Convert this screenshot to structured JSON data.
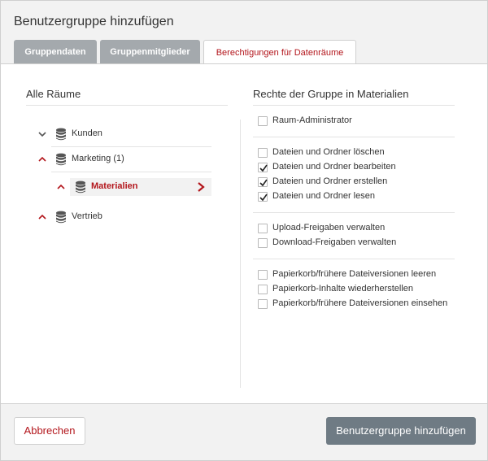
{
  "dialog": {
    "title": "Benutzergruppe hinzufügen"
  },
  "tabs": [
    {
      "label": "Gruppendaten",
      "active": false
    },
    {
      "label": "Gruppenmitglieder",
      "active": false
    },
    {
      "label": "Berechtigungen für Datenräume",
      "active": true
    }
  ],
  "rooms": {
    "title": "Alle Räume",
    "items": [
      {
        "label": "Kunden",
        "expanded": false,
        "icon": "database-icon"
      },
      {
        "label": "Marketing (1)",
        "expanded": true,
        "icon": "database-icon"
      },
      {
        "label": "Materialien",
        "expanded": true,
        "selected": true,
        "icon": "database-icon"
      },
      {
        "label": "Vertrieb",
        "expanded": true,
        "icon": "database-icon"
      }
    ]
  },
  "permissions": {
    "title": "Rechte der Gruppe in Materialien",
    "items": [
      {
        "label": "Raum-Administrator",
        "checked": false
      },
      {
        "label": "Dateien und Ordner löschen",
        "checked": false
      },
      {
        "label": "Dateien und Ordner bearbeiten",
        "checked": true
      },
      {
        "label": "Dateien und Ordner erstellen",
        "checked": true
      },
      {
        "label": "Dateien und Ordner lesen",
        "checked": true
      },
      {
        "label": "Upload-Freigaben verwalten",
        "checked": false
      },
      {
        "label": "Download-Freigaben verwalten",
        "checked": false
      },
      {
        "label": "Papierkorb/frühere Dateiversionen leeren",
        "checked": false
      },
      {
        "label": "Papierkorb-Inhalte wiederherstellen",
        "checked": false
      },
      {
        "label": "Papierkorb/frühere Dateiversionen einsehen",
        "checked": false
      }
    ]
  },
  "footer": {
    "cancel_label": "Abbrechen",
    "submit_label": "Benutzergruppe hinzufügen"
  },
  "colors": {
    "accent": "#b3161c",
    "tab_inactive": "#a4a9ad",
    "primary_button": "#6f7b84"
  }
}
